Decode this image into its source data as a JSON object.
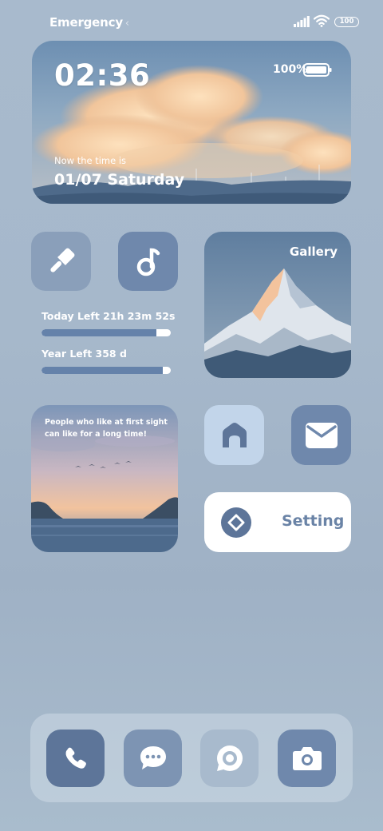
{
  "status_bar": {
    "carrier": "Emergency",
    "chevron": "‹",
    "battery_level": "100",
    "icons": [
      "signal-icon",
      "wifi-icon"
    ]
  },
  "hero_widget": {
    "time": "02:36",
    "battery_percent": "100%",
    "caption": "Now the time is",
    "date": "01/07 Saturday"
  },
  "apps": {
    "brush": {
      "icon": "brush-icon"
    },
    "music": {
      "icon": "music-note-icon"
    },
    "home": {
      "icon": "home-icon"
    },
    "mail": {
      "icon": "mail-icon"
    }
  },
  "countdown": {
    "today_label": "Today Left 21h 23m 52s",
    "today_progress": 0.89,
    "year_label": "Year Left 358 d",
    "year_progress": 0.94
  },
  "gallery_widget": {
    "label": "Gallery"
  },
  "quote_widget": {
    "line1": "People who like at first sight",
    "line2": "can like for a long time!"
  },
  "setting_widget": {
    "label": "Setting",
    "icon": "diamond-settings-icon"
  },
  "dock": {
    "apps": [
      "phone-icon",
      "message-icon",
      "browser-icon",
      "camera-icon"
    ]
  },
  "colors": {
    "wallpaper": "#a8bacd",
    "accent_dark": "#5d7599",
    "accent": "#6f88ac",
    "light_tile": "#c2d5ea"
  }
}
